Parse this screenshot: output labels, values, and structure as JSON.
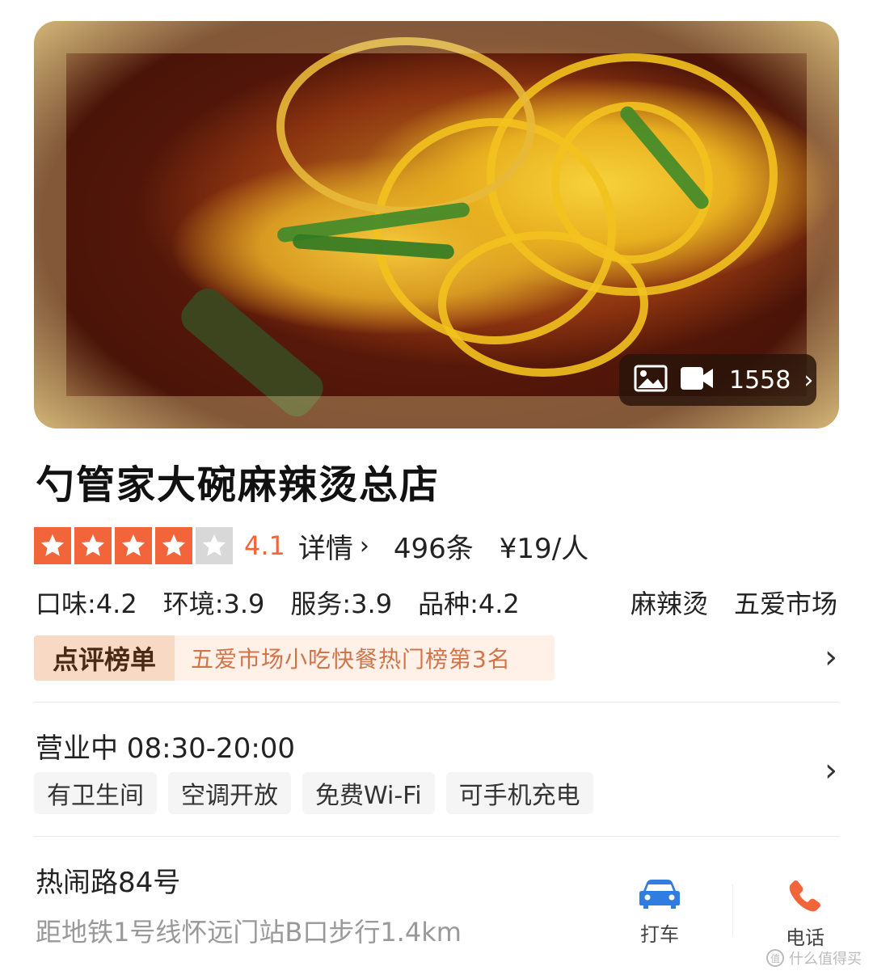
{
  "hero": {
    "media_count": "1558",
    "icons": [
      "image-icon",
      "video-icon",
      "chevron-right-icon"
    ]
  },
  "shop": {
    "name": "勺管家大碗麻辣烫总店",
    "rating": {
      "stars_filled": 4,
      "stars_total": 5,
      "score": "4.1",
      "detail_label": "详情",
      "review_count": "496条",
      "price": "¥19/人"
    },
    "subscores": [
      {
        "label": "口味:4.2"
      },
      {
        "label": "环境:3.9"
      },
      {
        "label": "服务:3.9"
      },
      {
        "label": "品种:4.2"
      }
    ],
    "category": "麻辣烫",
    "area": "五爱市场",
    "rank": {
      "badge": "点评榜单",
      "text": "五爱市场小吃快餐热门榜第3名"
    },
    "hours": "营业中 08:30-20:00",
    "amenities": [
      "有卫生间",
      "空调开放",
      "免费Wi-Fi",
      "可手机充电"
    ],
    "address": "热闹路84号",
    "distance": "距地铁1号线怀远门站B口步行1.4km"
  },
  "actions": {
    "taxi_label": "打车",
    "phone_label": "电话"
  },
  "colors": {
    "accent": "#f2653a",
    "rank_text": "#d0754a",
    "taxi_blue": "#2f7de1"
  },
  "watermark": "什么值得买"
}
